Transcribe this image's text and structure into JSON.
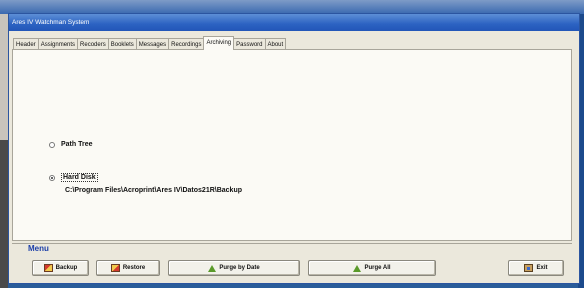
{
  "window": {
    "title": "Ares IV Watchman System"
  },
  "tabs": [
    {
      "label": "Header",
      "active": false
    },
    {
      "label": "Assignments",
      "active": false
    },
    {
      "label": "Recoders",
      "active": false
    },
    {
      "label": "Booklets",
      "active": false
    },
    {
      "label": "Messages",
      "active": false
    },
    {
      "label": "Recordings",
      "active": false
    },
    {
      "label": "Archiving",
      "active": true
    },
    {
      "label": "Password",
      "active": false
    },
    {
      "label": "About",
      "active": false
    }
  ],
  "archiving": {
    "options": [
      {
        "label": "Path Tree",
        "checked": false
      },
      {
        "label": "Hard Disk",
        "checked": true
      }
    ],
    "path": "C:\\Program Files\\Acroprint\\Ares IV\\Datos21R\\Backup"
  },
  "menu": {
    "label": "Menu",
    "buttons": {
      "backup": "Backup",
      "restore": "Restore",
      "purge_by_date": "Purge by Date",
      "purge_all": "Purge All",
      "exit": "Exit"
    }
  },
  "icons": {
    "backup": "backup-icon",
    "restore": "restore-icon",
    "purge_by_date": "broom-icon",
    "purge_all": "broom-icon",
    "exit": "exit-door-icon"
  },
  "colors": {
    "titlebar": "#2c62c2",
    "menu_label": "#1b3ea8",
    "window_bg": "#ebe8dc",
    "panel_bg": "#fbfaf5"
  }
}
